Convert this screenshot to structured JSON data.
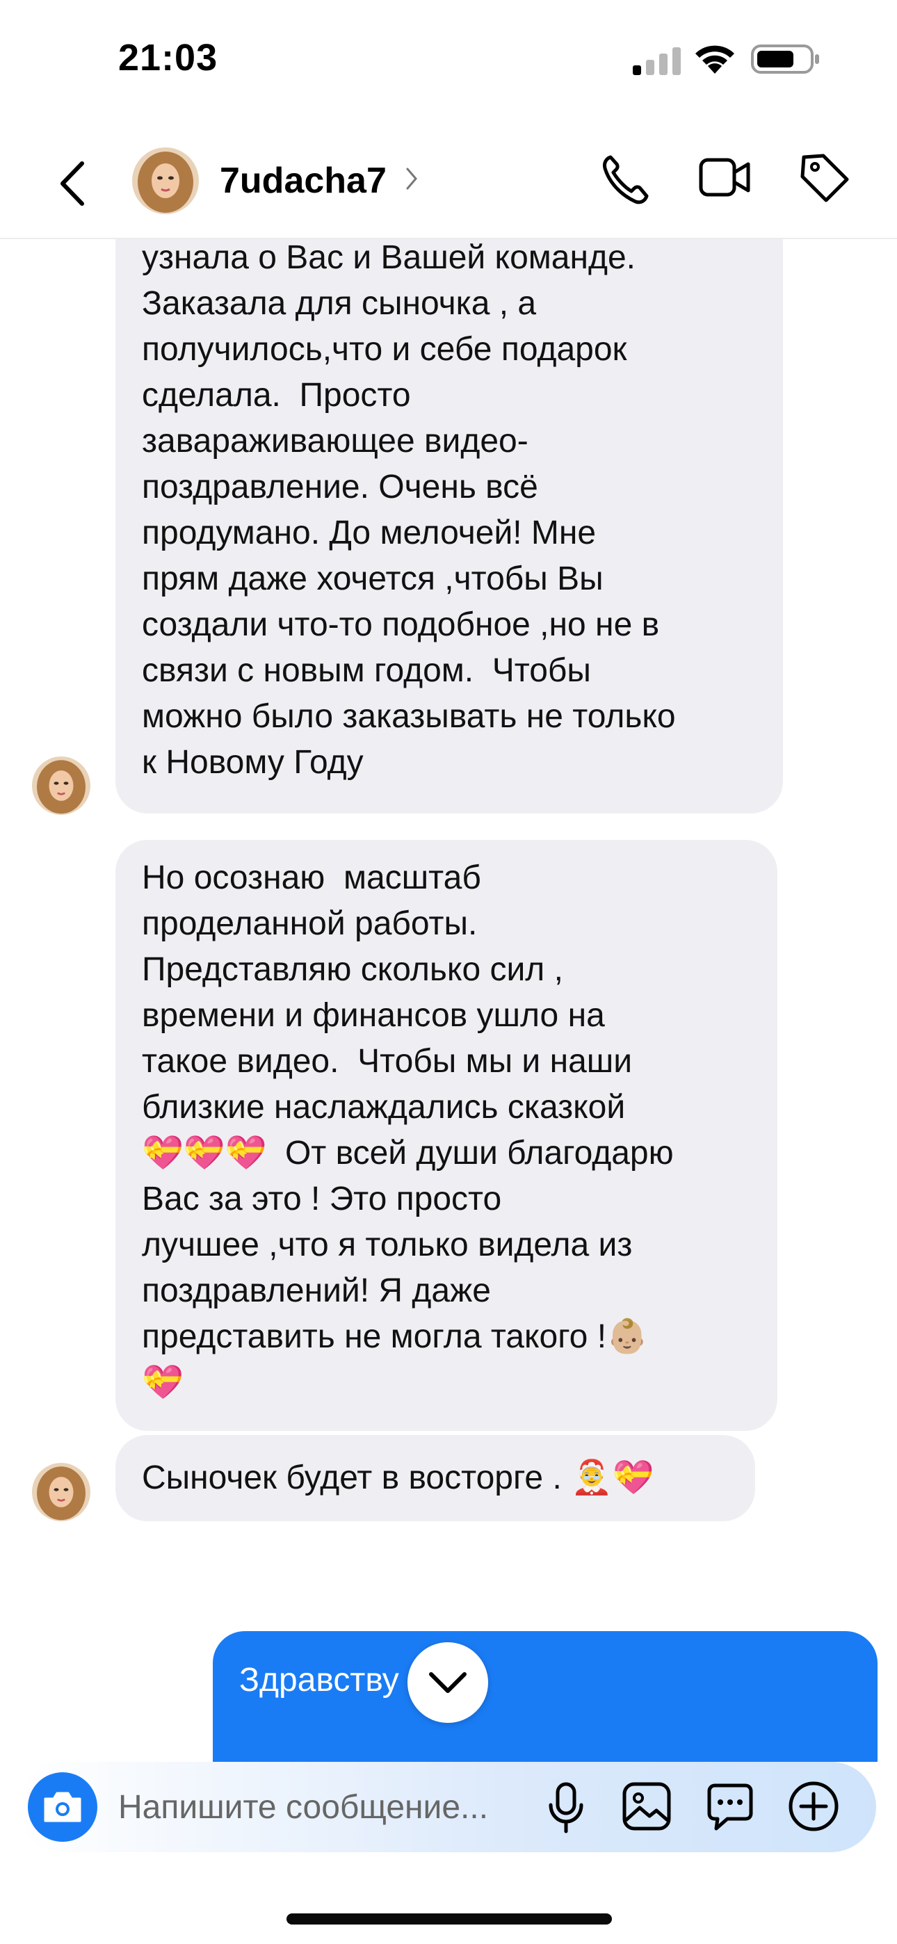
{
  "status_bar": {
    "time": "21:03"
  },
  "header": {
    "username": "7udacha7"
  },
  "messages": {
    "m1_text": "узнала о Вас и Вашей команде.\nЗаказала для сыночка , а\nполучилось,что и себе подарок\nсделала.  Просто\nзавараживающее видео-\nпоздравление. Очень всё\nпродумано. До мелочей! Мне\nпрям даже хочется ,чтобы Вы\nсоздали что-то подобное ,но не в\nсвязи с новым годом.  Чтобы\nможно было заказывать не только\nк Новому Году",
    "m2_text": "Но осознаю  масштаб\nпроделанной работы.\nПредставляю сколько сил ,\nвремени и финансов ушло на\nтакое видео.  Чтобы мы и наши\nблизкие наслаждались сказкой\n💝💝💝  От всей души благодарю\nВас за это ! Это просто\nлучшее ,что я только видела из\nпоздравлений! Я даже\nпредставить не могла такого !👶🏼\n💝",
    "m3_text": "Сыночек будет в восторге . 🤶💝",
    "m4_text": "Здравству 🌹 !"
  },
  "composer": {
    "placeholder": "Напишите сообщение..."
  },
  "icons": {
    "status": [
      "signal-icon",
      "wifi-icon",
      "battery-icon"
    ],
    "header": [
      "back-icon",
      "chevron-right-icon",
      "phone-icon",
      "video-camera-icon",
      "tag-icon"
    ],
    "composer": [
      "camera-icon",
      "microphone-icon",
      "gallery-icon",
      "sticker-icon",
      "plus-circle-icon"
    ],
    "chat": [
      "chevron-down-icon"
    ]
  },
  "colors": {
    "outgoing_bubble": "#1a7cf5",
    "incoming_bubble": "#efeff3",
    "accent": "#1a7cf5"
  }
}
